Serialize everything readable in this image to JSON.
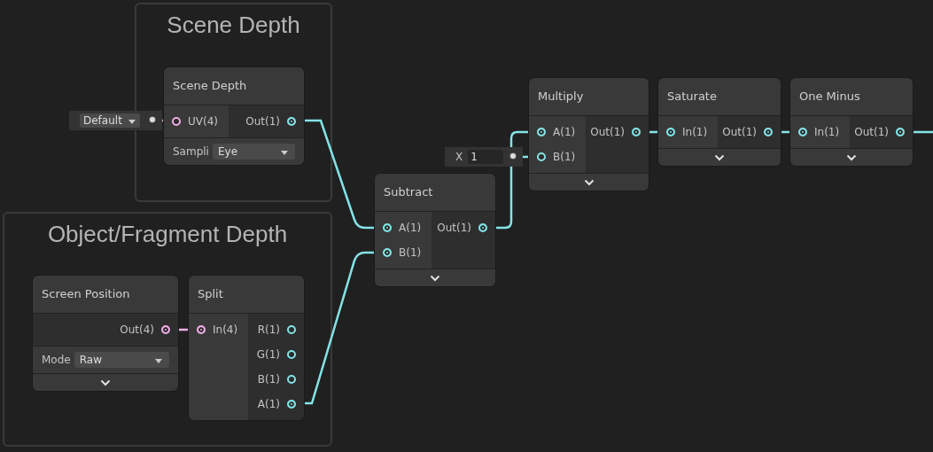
{
  "groups": [
    {
      "title": "Scene Depth"
    },
    {
      "title": "Object/Fragment Depth"
    }
  ],
  "nodes": [
    {
      "title": "Scene Depth",
      "inputs": [
        {
          "label": "UV(4)",
          "color": "#f1aee9",
          "connected": false
        }
      ],
      "outputs": [
        {
          "label": "Out(1)",
          "color": "#84e4e7",
          "connected": true
        }
      ],
      "controls": [
        {
          "label": "Sampli",
          "value": "Eye"
        }
      ],
      "collapsible": false
    },
    {
      "title": "Multiply",
      "inputs": [
        {
          "label": "A(1)",
          "color": "#84e4e7",
          "connected": true
        },
        {
          "label": "B(1)",
          "color": "#84e4e7",
          "connected": false
        }
      ],
      "outputs": [
        {
          "label": "Out(1)",
          "color": "#84e4e7",
          "connected": true
        }
      ],
      "collapsible": true
    },
    {
      "title": "Saturate",
      "inputs": [
        {
          "label": "In(1)",
          "color": "#84e4e7",
          "connected": true
        }
      ],
      "outputs": [
        {
          "label": "Out(1)",
          "color": "#84e4e7",
          "connected": true
        }
      ],
      "collapsible": true
    },
    {
      "title": "One Minus",
      "inputs": [
        {
          "label": "In(1)",
          "color": "#84e4e7",
          "connected": true
        }
      ],
      "outputs": [
        {
          "label": "Out(1)",
          "color": "#84e4e7",
          "connected": true
        }
      ],
      "collapsible": true
    },
    {
      "title": "Subtract",
      "inputs": [
        {
          "label": "A(1)",
          "color": "#84e4e7",
          "connected": true
        },
        {
          "label": "B(1)",
          "color": "#84e4e7",
          "connected": true
        }
      ],
      "outputs": [
        {
          "label": "Out(1)",
          "color": "#84e4e7",
          "connected": true
        }
      ],
      "collapsible": true
    },
    {
      "title": "Screen Position",
      "outputs": [
        {
          "label": "Out(4)",
          "color": "#f1aee9",
          "connected": true
        }
      ],
      "controls": [
        {
          "label": "Mode",
          "value": "Raw"
        }
      ],
      "collapsible": true
    },
    {
      "title": "Split",
      "inputs": [
        {
          "label": "In(4)",
          "color": "#f1aee9",
          "connected": true
        }
      ],
      "outputs": [
        {
          "label": "R(1)",
          "color": "#84e4e7",
          "connected": false
        },
        {
          "label": "G(1)",
          "color": "#84e4e7",
          "connected": false
        },
        {
          "label": "B(1)",
          "color": "#84e4e7",
          "connected": false
        },
        {
          "label": "A(1)",
          "color": "#84e4e7",
          "connected": true
        }
      ],
      "collapsible": false
    }
  ],
  "inline_inputs": [
    {
      "kind": "dropdown",
      "value": "Default"
    },
    {
      "kind": "number",
      "label": "X",
      "value": "1"
    }
  ]
}
